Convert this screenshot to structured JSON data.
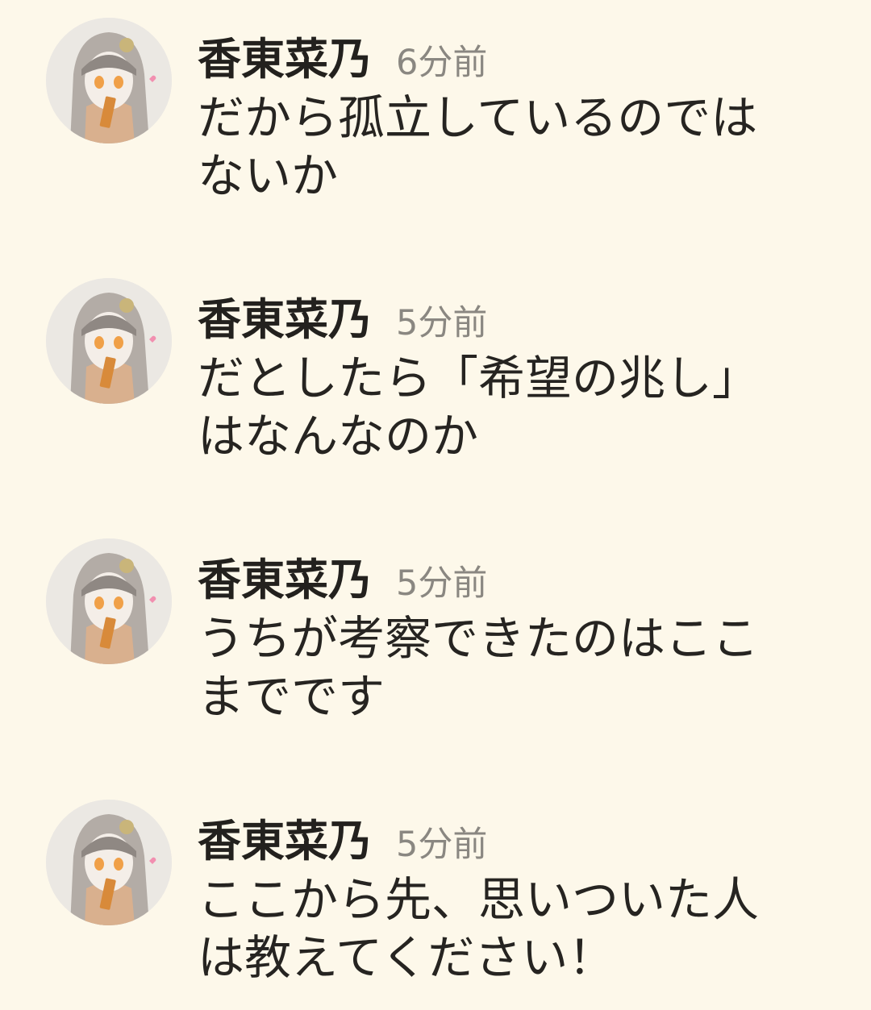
{
  "messages": [
    {
      "author": "香東菜乃",
      "time": "6分前",
      "lines": [
        "だから孤立しているのでは",
        "ないか"
      ],
      "avatar_icon": "user-avatar-icon"
    },
    {
      "author": "香東菜乃",
      "time": "5分前",
      "lines": [
        "だとしたら「希望の兆し」",
        "はなんなのか"
      ],
      "avatar_icon": "user-avatar-icon"
    },
    {
      "author": "香東菜乃",
      "time": "5分前",
      "lines": [
        "うちが考察できたのはここ",
        "までです"
      ],
      "avatar_icon": "user-avatar-icon"
    },
    {
      "author": "香東菜乃",
      "time": "5分前",
      "lines": [
        "ここから先、思いついた人",
        "は教えてください！"
      ],
      "avatar_icon": "user-avatar-icon"
    }
  ],
  "colors": {
    "background": "#fdf8ea",
    "text": "#262421",
    "time": "#8a8781",
    "hair": "#a49d98",
    "eyes": "#f0a048",
    "heart": "#f28fb0"
  }
}
